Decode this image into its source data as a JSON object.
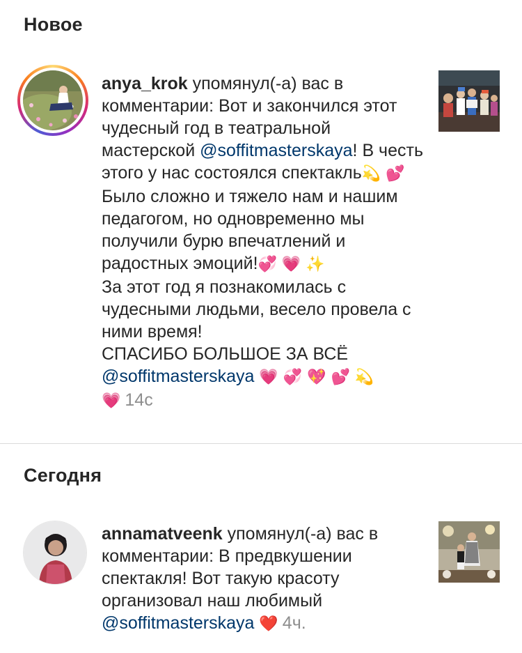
{
  "sections": {
    "new_title": "Новое",
    "today_title": "Сегодня"
  },
  "notifications": [
    {
      "username": "anya_krok",
      "action": " упомянул(-а) вас в комментарии: ",
      "p1": "Вот и закончился этот чудесный год в театральной мастерской ",
      "mention1": "@soffitmasterskaya",
      "p2": "! В честь этого у нас состоялся спектакль",
      "emoji_1": "💫",
      "emoji_2": "💕",
      "p3": " Было сложно и тяжело нам и нашим педагогом, но одновременно мы получили бурю впечатлений и радостных эмоций!",
      "emoji_3": "💞",
      "emoji_4": "💗",
      "emoji_5": "✨",
      "line2": "За этот год я познакомилась с чудесными людьми, весело провела с ними время!",
      "line3": "СПАСИБО БОЛЬШОЕ ЗА ВСЁ",
      "mention2": "@soffitmasterskaya",
      "emoji_6": "💗",
      "emoji_7": "💞",
      "emoji_8": "💖",
      "emoji_9": "💕",
      "emoji_10": "💫",
      "emoji_11": "💗",
      "time": "14с",
      "avatar_icon": "profile-photo",
      "thumbnail_icon": "post-thumbnail"
    },
    {
      "username": "annamatveenk",
      "action": " упомянул(-а) вас в комментарии: ",
      "p1": "В предвкушении спектакля! Вот такую красоту организовал наш любимый ",
      "mention1": "@soffitmasterskaya",
      "emoji_1": "❤️",
      "time": "4ч.",
      "avatar_icon": "profile-photo",
      "thumbnail_icon": "post-thumbnail"
    }
  ]
}
